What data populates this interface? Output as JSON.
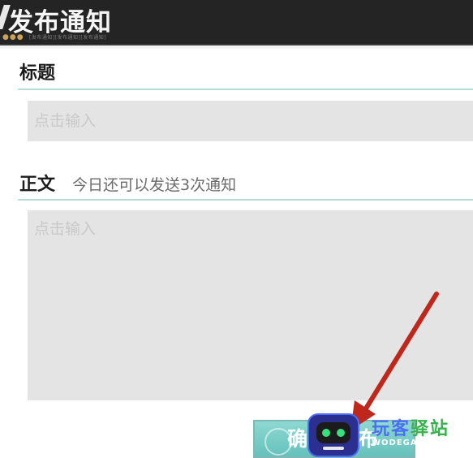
{
  "header": {
    "title": "发布通知",
    "dots": "●●●",
    "subtitle": "[发布通知][发布通知][发布通知]"
  },
  "form": {
    "title_section": {
      "label": "标题",
      "placeholder": "点击输入"
    },
    "body_section": {
      "label": "正文",
      "hint": "今日还可以发送3次通知",
      "placeholder": "点击输入"
    },
    "send_button_label": "确认发布"
  },
  "watermark": {
    "brand_part1": "玩客",
    "brand_part2": "驿站",
    "domain": "WODEGAME.CN"
  },
  "colors": {
    "header_bg": "#242424",
    "accent_line": "#b9dcd7",
    "field_bg": "#e4e4e4",
    "button_bg": "#7fcfc8",
    "arrow": "#c0271c"
  },
  "icons": {
    "annotation": "red-arrow-icon",
    "watermark": "robot-logo-icon"
  }
}
